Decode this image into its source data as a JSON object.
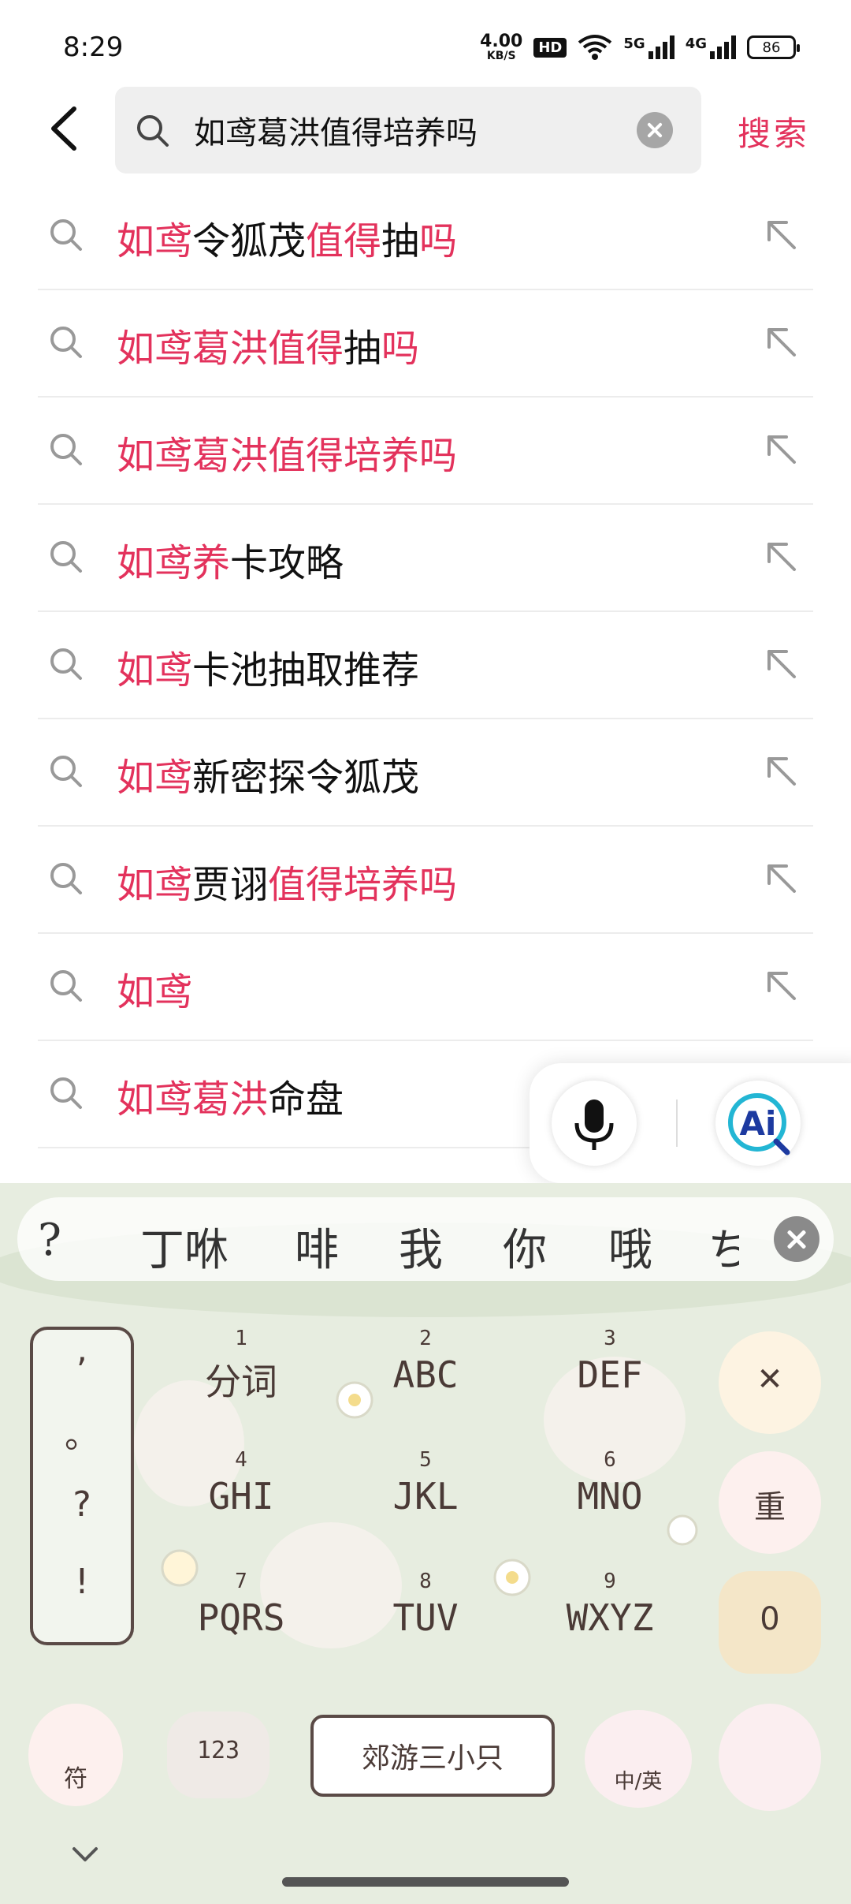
{
  "status_bar": {
    "time": "8:29",
    "net_speed_value": "4.00",
    "net_speed_unit": "KB/S",
    "hd_label": "HD",
    "sim1_label": "5G",
    "sim2_label": "4G",
    "battery": "86"
  },
  "search": {
    "query": "如鸢葛洪值得培养吗",
    "submit_label": "搜索"
  },
  "suggestions": [
    [
      {
        "t": "如鸢",
        "h": true
      },
      {
        "t": "令狐茂",
        "h": false
      },
      {
        "t": "值得",
        "h": true
      },
      {
        "t": "抽",
        "h": false
      },
      {
        "t": "吗",
        "h": true
      }
    ],
    [
      {
        "t": "如鸢葛洪值得",
        "h": true
      },
      {
        "t": "抽",
        "h": false
      },
      {
        "t": "吗",
        "h": true
      }
    ],
    [
      {
        "t": "如鸢葛洪值得培养吗",
        "h": true
      }
    ],
    [
      {
        "t": "如鸢养",
        "h": true
      },
      {
        "t": "卡攻略",
        "h": false
      }
    ],
    [
      {
        "t": "如鸢",
        "h": true
      },
      {
        "t": "卡池抽取推荐",
        "h": false
      }
    ],
    [
      {
        "t": "如鸢",
        "h": true
      },
      {
        "t": "新密探令狐茂",
        "h": false
      }
    ],
    [
      {
        "t": "如鸢",
        "h": true
      },
      {
        "t": "贾诩",
        "h": false
      },
      {
        "t": "值得培养吗",
        "h": true
      }
    ],
    [
      {
        "t": "如鸢",
        "h": true
      }
    ],
    [
      {
        "t": "如鸢葛洪",
        "h": true
      },
      {
        "t": "命盘",
        "h": false
      }
    ]
  ],
  "floating_panel": {
    "ai_label": "Ai"
  },
  "keyboard": {
    "candidates": [
      "?",
      "丁咻",
      "啡",
      "我",
      "你",
      "哦",
      "ち"
    ],
    "punctuation": [
      ",",
      "。",
      "?",
      "!"
    ],
    "keys": [
      {
        "num": "1",
        "label": "分词"
      },
      {
        "num": "2",
        "label": "ABC"
      },
      {
        "num": "3",
        "label": "DEF"
      },
      {
        "num": "4",
        "label": "GHI"
      },
      {
        "num": "5",
        "label": "JKL"
      },
      {
        "num": "6",
        "label": "MNO"
      },
      {
        "num": "7",
        "label": "PQRS"
      },
      {
        "num": "8",
        "label": "TUV"
      },
      {
        "num": "9",
        "label": "WXYZ"
      }
    ],
    "delete_symbol": "✕",
    "reset_label": "重",
    "zero_label": "0",
    "symbol_key_label": "符",
    "numeric_key_label": "123",
    "space_label": "郊游三小只",
    "lang_key_label": "中/英"
  },
  "colors": {
    "highlight": "#e3325c",
    "keyboard_bg": "#e7ede0",
    "search_box_bg": "#efefef"
  }
}
